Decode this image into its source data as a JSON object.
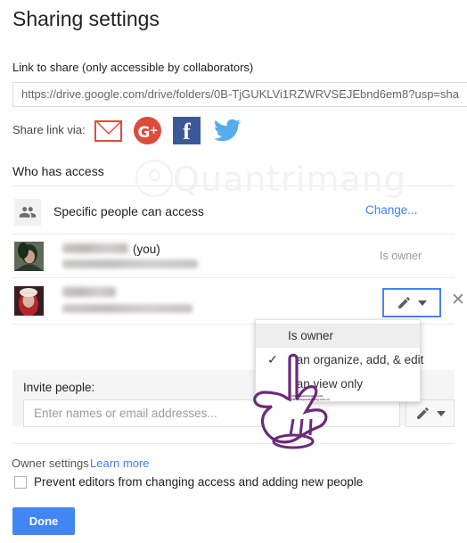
{
  "dialog": {
    "title": "Sharing settings"
  },
  "link_section": {
    "label": "Link to share (only accessible by collaborators)",
    "url": "https://drive.google.com/drive/folders/0B-TjGUKLVi1RZWRVSEJEbnd6em8?usp=sha"
  },
  "share_via": {
    "label": "Share link via:",
    "icons": [
      {
        "name": "gmail-icon",
        "glyph": "M"
      },
      {
        "name": "google-plus-icon",
        "glyph": "G+"
      },
      {
        "name": "facebook-icon",
        "glyph": "f"
      },
      {
        "name": "twitter-icon",
        "glyph": "bird"
      }
    ]
  },
  "who_has_access": {
    "title": "Who has access",
    "access_level": "Specific people can access",
    "access_icon": "people-icon",
    "change_link": "Change...",
    "people": [
      {
        "name": "",
        "you_suffix": "(you)",
        "email": "",
        "role": "Is owner"
      },
      {
        "name": "",
        "you_suffix": "",
        "email": "",
        "role": ""
      }
    ]
  },
  "permission_dropdown": {
    "items": [
      {
        "label": "Is owner",
        "checked": false,
        "hovered": true
      },
      {
        "label": "Can organize, add, & edit",
        "checked": true,
        "hovered": false
      },
      {
        "label": "Can view only",
        "checked": false,
        "hovered": false
      }
    ],
    "check_glyph": "✓"
  },
  "invite": {
    "label": "Invite people:",
    "placeholder": "Enter names or email addresses...",
    "value": ""
  },
  "owner_settings": {
    "label": "Owner settings",
    "learn_more": "Learn more",
    "checkbox_label": "Prevent editors from changing access and adding new people",
    "checkbox_checked": false
  },
  "footer": {
    "done_label": "Done"
  },
  "watermark": {
    "text": "Quantrimang",
    "hand_line1": "http://quantrimang.com/",
    "hand_line2": "FB.com/quantrimang.com.vn"
  },
  "colors": {
    "accent_blue": "#4285f4",
    "link_blue": "#427fed",
    "highlight_red": "#f40000",
    "panel_gray": "#f5f5f5",
    "gmail_red": "#e24b3b",
    "gplus_red": "#dd4b39",
    "facebook_blue": "#3b5998",
    "twitter_blue": "#55acee",
    "hand_purple": "#6b2a7a"
  }
}
